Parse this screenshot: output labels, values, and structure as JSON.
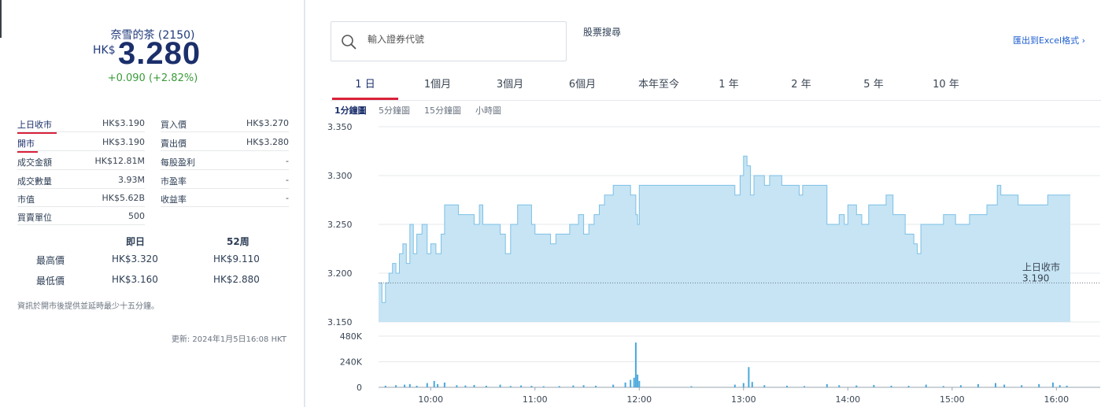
{
  "quote": {
    "name": "奈雪的茶 (2150)",
    "currency": "HK$",
    "price": "3.280",
    "change": "+0.090 (+2.82%)"
  },
  "stats_left": [
    {
      "label": "上日收市",
      "value": "HK$3.190"
    },
    {
      "label": "開市",
      "value": "HK$3.190"
    },
    {
      "label": "成交金額",
      "value": "HK$12.81M"
    },
    {
      "label": "成交數量",
      "value": "3.93M"
    },
    {
      "label": "市值",
      "value": "HK$5.62B"
    },
    {
      "label": "買賣單位",
      "value": "500"
    }
  ],
  "stats_right": [
    {
      "label": "買入價",
      "value": "HK$3.270"
    },
    {
      "label": "賣出價",
      "value": "HK$3.280"
    },
    {
      "label": "每股盈利",
      "value": "-"
    },
    {
      "label": "市盈率",
      "value": "-"
    },
    {
      "label": "收益率",
      "value": "-"
    }
  ],
  "range_table": {
    "col_intraday": "即日",
    "col_52w": "52周",
    "rows": [
      {
        "label": "最高價",
        "intraday": "HK$3.320",
        "w52": "HK$9.110"
      },
      {
        "label": "最低價",
        "intraday": "HK$3.160",
        "w52": "HK$2.880"
      }
    ]
  },
  "note": "資訊於開市後提供並延時最少十五分鐘。",
  "updated": "更新: 2024年1月5日16:08 HKT",
  "search": {
    "placeholder": "輸入證券代號",
    "label": "股票搜尋"
  },
  "export_label": "匯出到Excel格式 ›",
  "period_tabs": [
    "1 日",
    "1個月",
    "3個月",
    "6個月",
    "本年至今",
    "1 年",
    "2 年",
    "5 年",
    "10 年"
  ],
  "active_period": 0,
  "interval_tabs": [
    "1分鐘圖",
    "5分鐘圖",
    "15分鐘圖",
    "小時圖"
  ],
  "active_interval": 0,
  "colors": {
    "accent": "#d9213a",
    "price_fill": "#c6e4f4",
    "price_line": "#7cc0e6",
    "volume": "#4aa8dc",
    "positive": "#3a9b3a",
    "link": "#1f5fd1"
  },
  "icons": {
    "search": "search-icon"
  },
  "chart_data": [
    {
      "type": "area",
      "ylim": [
        3.15,
        3.35
      ],
      "yticks": [
        "3.350",
        "3.300",
        "3.250",
        "3.200",
        "3.150"
      ],
      "reference_line": {
        "label": "上日收市",
        "value_label": "3.190",
        "value": 3.19
      },
      "x_start": "09:30",
      "x_end": "16:08",
      "grid": true,
      "points": [
        [
          "09:30",
          3.19
        ],
        [
          "09:32",
          3.17
        ],
        [
          "09:34",
          3.19
        ],
        [
          "09:36",
          3.2
        ],
        [
          "09:38",
          3.21
        ],
        [
          "09:40",
          3.2
        ],
        [
          "09:42",
          3.22
        ],
        [
          "09:44",
          3.23
        ],
        [
          "09:46",
          3.21
        ],
        [
          "09:48",
          3.25
        ],
        [
          "09:50",
          3.22
        ],
        [
          "09:52",
          3.24
        ],
        [
          "09:55",
          3.25
        ],
        [
          "09:58",
          3.22
        ],
        [
          "10:00",
          3.23
        ],
        [
          "10:03",
          3.22
        ],
        [
          "10:06",
          3.24
        ],
        [
          "10:08",
          3.27
        ],
        [
          "10:12",
          3.27
        ],
        [
          "10:16",
          3.26
        ],
        [
          "10:22",
          3.26
        ],
        [
          "10:25",
          3.25
        ],
        [
          "10:28",
          3.27
        ],
        [
          "10:30",
          3.25
        ],
        [
          "10:35",
          3.25
        ],
        [
          "10:40",
          3.24
        ],
        [
          "10:43",
          3.22
        ],
        [
          "10:46",
          3.25
        ],
        [
          "10:50",
          3.27
        ],
        [
          "10:56",
          3.27
        ],
        [
          "10:58",
          3.25
        ],
        [
          "11:00",
          3.24
        ],
        [
          "11:06",
          3.24
        ],
        [
          "11:09",
          3.23
        ],
        [
          "11:12",
          3.24
        ],
        [
          "11:18",
          3.24
        ],
        [
          "11:20",
          3.25
        ],
        [
          "11:22",
          3.25
        ],
        [
          "11:25",
          3.26
        ],
        [
          "11:28",
          3.24
        ],
        [
          "11:31",
          3.25
        ],
        [
          "11:34",
          3.26
        ],
        [
          "11:37",
          3.27
        ],
        [
          "11:40",
          3.28
        ],
        [
          "11:45",
          3.29
        ],
        [
          "11:53",
          3.29
        ],
        [
          "11:55",
          3.28
        ],
        [
          "11:58",
          3.26
        ],
        [
          "11:59",
          3.25
        ],
        [
          "12:00",
          3.29
        ],
        [
          "12:30",
          3.29
        ],
        [
          "12:45",
          3.29
        ],
        [
          "12:55",
          3.28
        ],
        [
          "12:58",
          3.3
        ],
        [
          "13:00",
          3.32
        ],
        [
          "13:02",
          3.31
        ],
        [
          "13:04",
          3.28
        ],
        [
          "13:06",
          3.3
        ],
        [
          "13:08",
          3.3
        ],
        [
          "13:12",
          3.29
        ],
        [
          "13:15",
          3.3
        ],
        [
          "13:20",
          3.3
        ],
        [
          "13:22",
          3.29
        ],
        [
          "13:30",
          3.29
        ],
        [
          "13:32",
          3.28
        ],
        [
          "13:34",
          3.29
        ],
        [
          "13:40",
          3.29
        ],
        [
          "13:42",
          3.29
        ],
        [
          "13:46",
          3.29
        ],
        [
          "13:48",
          3.25
        ],
        [
          "13:52",
          3.25
        ],
        [
          "13:55",
          3.26
        ],
        [
          "13:58",
          3.25
        ],
        [
          "14:00",
          3.27
        ],
        [
          "14:05",
          3.26
        ],
        [
          "14:08",
          3.25
        ],
        [
          "14:12",
          3.27
        ],
        [
          "14:18",
          3.27
        ],
        [
          "14:22",
          3.28
        ],
        [
          "14:26",
          3.26
        ],
        [
          "14:30",
          3.26
        ],
        [
          "14:33",
          3.24
        ],
        [
          "14:36",
          3.24
        ],
        [
          "14:38",
          3.23
        ],
        [
          "14:40",
          3.22
        ],
        [
          "14:42",
          3.25
        ],
        [
          "14:50",
          3.25
        ],
        [
          "14:55",
          3.26
        ],
        [
          "15:00",
          3.26
        ],
        [
          "15:02",
          3.25
        ],
        [
          "15:08",
          3.25
        ],
        [
          "15:10",
          3.26
        ],
        [
          "15:15",
          3.26
        ],
        [
          "15:18",
          3.26
        ],
        [
          "15:20",
          3.27
        ],
        [
          "15:24",
          3.27
        ],
        [
          "15:26",
          3.29
        ],
        [
          "15:28",
          3.28
        ],
        [
          "15:32",
          3.28
        ],
        [
          "15:35",
          3.28
        ],
        [
          "15:38",
          3.27
        ],
        [
          "15:42",
          3.27
        ],
        [
          "15:46",
          3.27
        ],
        [
          "15:50",
          3.27
        ],
        [
          "15:55",
          3.28
        ],
        [
          "16:00",
          3.28
        ],
        [
          "16:08",
          3.28
        ]
      ]
    },
    {
      "type": "bar",
      "ylim": [
        0,
        480000
      ],
      "yticks": [
        "480K",
        "240K",
        "0"
      ],
      "xticks": [
        "10:00",
        "11:00",
        "12:00",
        "13:00",
        "14:00",
        "15:00",
        "16:00"
      ],
      "points": [
        [
          "09:34",
          15000
        ],
        [
          "09:40",
          20000
        ],
        [
          "09:45",
          25000
        ],
        [
          "09:48",
          30000
        ],
        [
          "09:52",
          15000
        ],
        [
          "09:58",
          40000
        ],
        [
          "10:02",
          60000
        ],
        [
          "10:04",
          30000
        ],
        [
          "10:08",
          45000
        ],
        [
          "10:15",
          20000
        ],
        [
          "10:20",
          18000
        ],
        [
          "10:25",
          22000
        ],
        [
          "10:32",
          15000
        ],
        [
          "10:40",
          25000
        ],
        [
          "10:46",
          12000
        ],
        [
          "10:52",
          18000
        ],
        [
          "10:58",
          14000
        ],
        [
          "11:05",
          10000
        ],
        [
          "11:14",
          12000
        ],
        [
          "11:22",
          18000
        ],
        [
          "11:28",
          20000
        ],
        [
          "11:35",
          15000
        ],
        [
          "11:45",
          25000
        ],
        [
          "11:52",
          45000
        ],
        [
          "11:55",
          70000
        ],
        [
          "11:57",
          90000
        ],
        [
          "11:58",
          420000
        ],
        [
          "11:59",
          120000
        ],
        [
          "12:00",
          60000
        ],
        [
          "12:30",
          10000
        ],
        [
          "12:55",
          25000
        ],
        [
          "13:00",
          40000
        ],
        [
          "13:03",
          190000
        ],
        [
          "13:05",
          50000
        ],
        [
          "13:12",
          20000
        ],
        [
          "13:25",
          15000
        ],
        [
          "13:35",
          12000
        ],
        [
          "13:48",
          30000
        ],
        [
          "13:55",
          20000
        ],
        [
          "14:05",
          18000
        ],
        [
          "14:15",
          22000
        ],
        [
          "14:25",
          15000
        ],
        [
          "14:35",
          14000
        ],
        [
          "14:45",
          25000
        ],
        [
          "14:55",
          12000
        ],
        [
          "15:05",
          20000
        ],
        [
          "15:15",
          30000
        ],
        [
          "15:25",
          40000
        ],
        [
          "15:30",
          25000
        ],
        [
          "15:40",
          20000
        ],
        [
          "15:50",
          30000
        ],
        [
          "15:58",
          45000
        ],
        [
          "16:02",
          20000
        ],
        [
          "16:06",
          15000
        ]
      ]
    }
  ]
}
